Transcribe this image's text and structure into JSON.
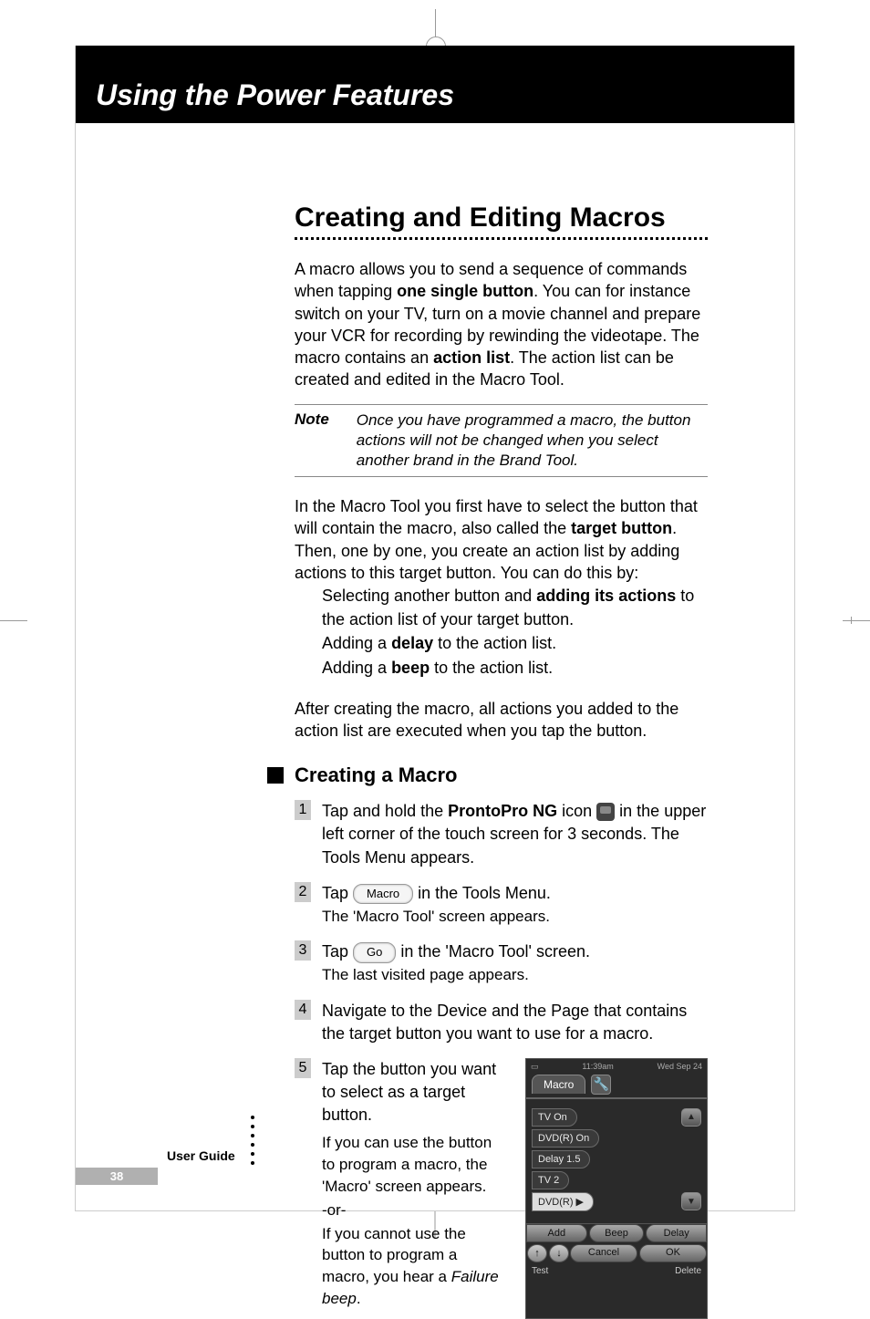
{
  "header_title": "Using the Power Features",
  "main_heading": "Creating and Editing Macros",
  "intro": {
    "part1": "A macro allows you to send a sequence of commands when tapping ",
    "bold1": "one single button",
    "part2": ". You can for instance switch on your TV, turn on a movie channel and prepare your VCR for recording by rewinding the videotape. The macro contains an ",
    "bold2": "action list",
    "part3": ". The action list can be created and edited in the Macro Tool."
  },
  "note": {
    "label": "Note",
    "text": "Once you have programmed a macro, the button actions will not be changed when you select another brand in the Brand Tool."
  },
  "para2": {
    "part1": "In the Macro Tool you first have to select the button that will contain the macro, also called the ",
    "bold1": "target button",
    "part2": ". Then, one by one, you create an action list by adding actions to this target button. You can do this by:"
  },
  "bullets": {
    "b1_p1": "Selecting another button and ",
    "b1_bold": "adding its actions",
    "b1_p2": " to the action list of your target button.",
    "b2_p1": "Adding a ",
    "b2_bold": "delay",
    "b2_p2": " to the action list.",
    "b3_p1": "Adding a ",
    "b3_bold": "beep",
    "b3_p2": " to the action list."
  },
  "para3": "After creating the macro, all actions you added to the action list are executed when you tap the button.",
  "sub_heading": "Creating a Macro",
  "steps": {
    "s1_p1": "Tap and hold the ",
    "s1_bold1": "ProntoPro NG",
    "s1_p2": " icon ",
    "s1_p3": " in the upper left corner of the touch screen for 3 seconds.",
    "s1_sub": " The Tools Menu appears.",
    "s2_p1": "Tap ",
    "s2_btn": "Macro",
    "s2_p2": " in the Tools Menu.",
    "s2_sub": "The 'Macro Tool' screen appears.",
    "s3_p1": "Tap ",
    "s3_btn": "Go",
    "s3_p2": " in the 'Macro Tool' screen.",
    "s3_sub": "The last visited page appears.",
    "s4": "Navigate to the Device and the Page that contains the target button you want to use for a macro.",
    "s5_p1": "Tap the button you want to select as a target button.",
    "s5_p2": "If you can use the button to program a macro, the 'Macro' screen appears.",
    "s5_or": "-or-",
    "s5_p3a": "If you cannot use the button to program a macro, you hear a ",
    "s5_p3b": "Failure beep",
    "s5_p3c": "."
  },
  "device": {
    "time": "11:39am",
    "date": "Wed Sep 24",
    "tab": "Macro",
    "items": {
      "i1": "TV On",
      "i2": "DVD(R) On",
      "i3": "Delay 1.5",
      "i4": "TV 2",
      "i5": "DVD(R) ▶"
    },
    "add": "Add",
    "beep": "Beep",
    "delay": "Delay",
    "cancel": "Cancel",
    "ok": "OK",
    "test": "Test",
    "delete": "Delete"
  },
  "footer": {
    "label": "User Guide",
    "page": "38"
  }
}
